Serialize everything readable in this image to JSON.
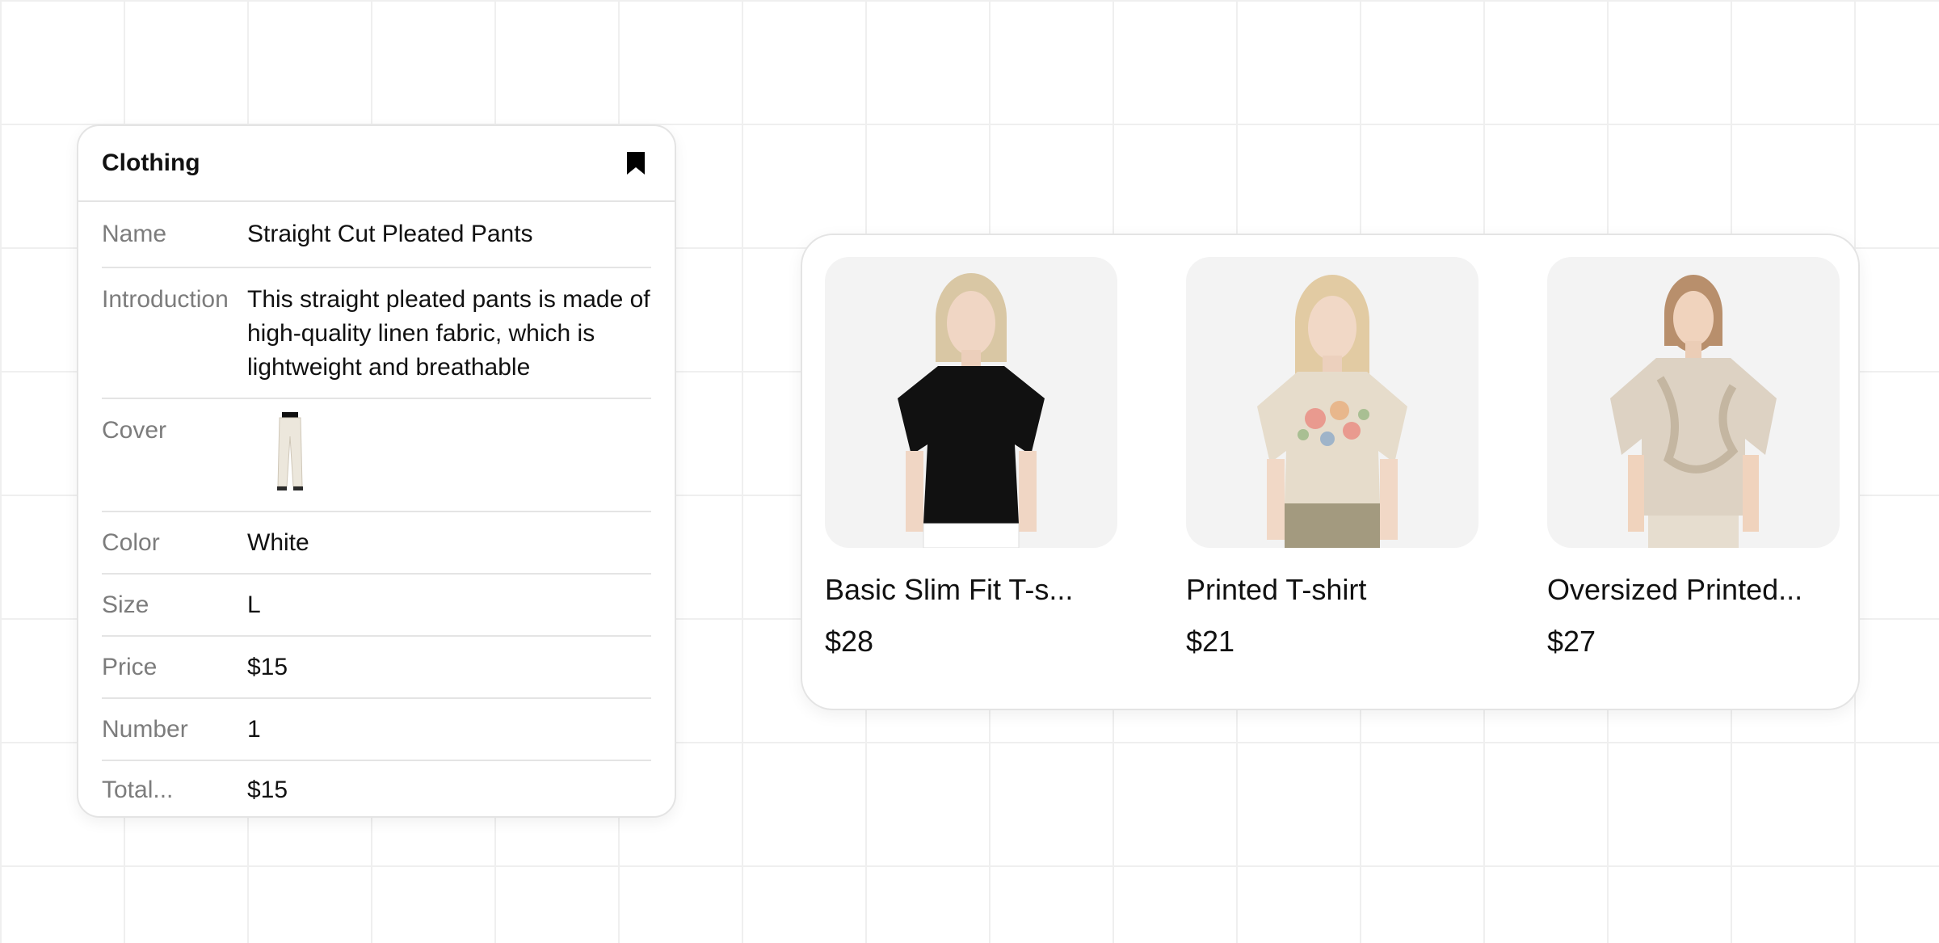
{
  "detail": {
    "title": "Clothing",
    "bookmark_icon": "bookmark-icon",
    "fields": {
      "name": {
        "label": "Name",
        "value": "Straight Cut Pleated Pants"
      },
      "introduction": {
        "label": "Introduction",
        "value": "This straight pleated pants is made of high-quality linen fabric, which is lightweight and breathable"
      },
      "cover": {
        "label": "Cover"
      },
      "color": {
        "label": "Color",
        "value": "White"
      },
      "size": {
        "label": "Size",
        "value": "L"
      },
      "price": {
        "label": "Price",
        "value": "$15"
      },
      "number": {
        "label": "Number",
        "value": "1"
      },
      "total": {
        "label": "Total...",
        "value": "$15"
      }
    }
  },
  "products": [
    {
      "name": "Basic Slim Fit T-s...",
      "price": "$28",
      "shirt_color": "#111111"
    },
    {
      "name": "Printed T-shirt",
      "price": "$21",
      "shirt_color": "#e6dccb"
    },
    {
      "name": "Oversized Printed...",
      "price": "$27",
      "shirt_color": "#ddd2c3"
    }
  ]
}
